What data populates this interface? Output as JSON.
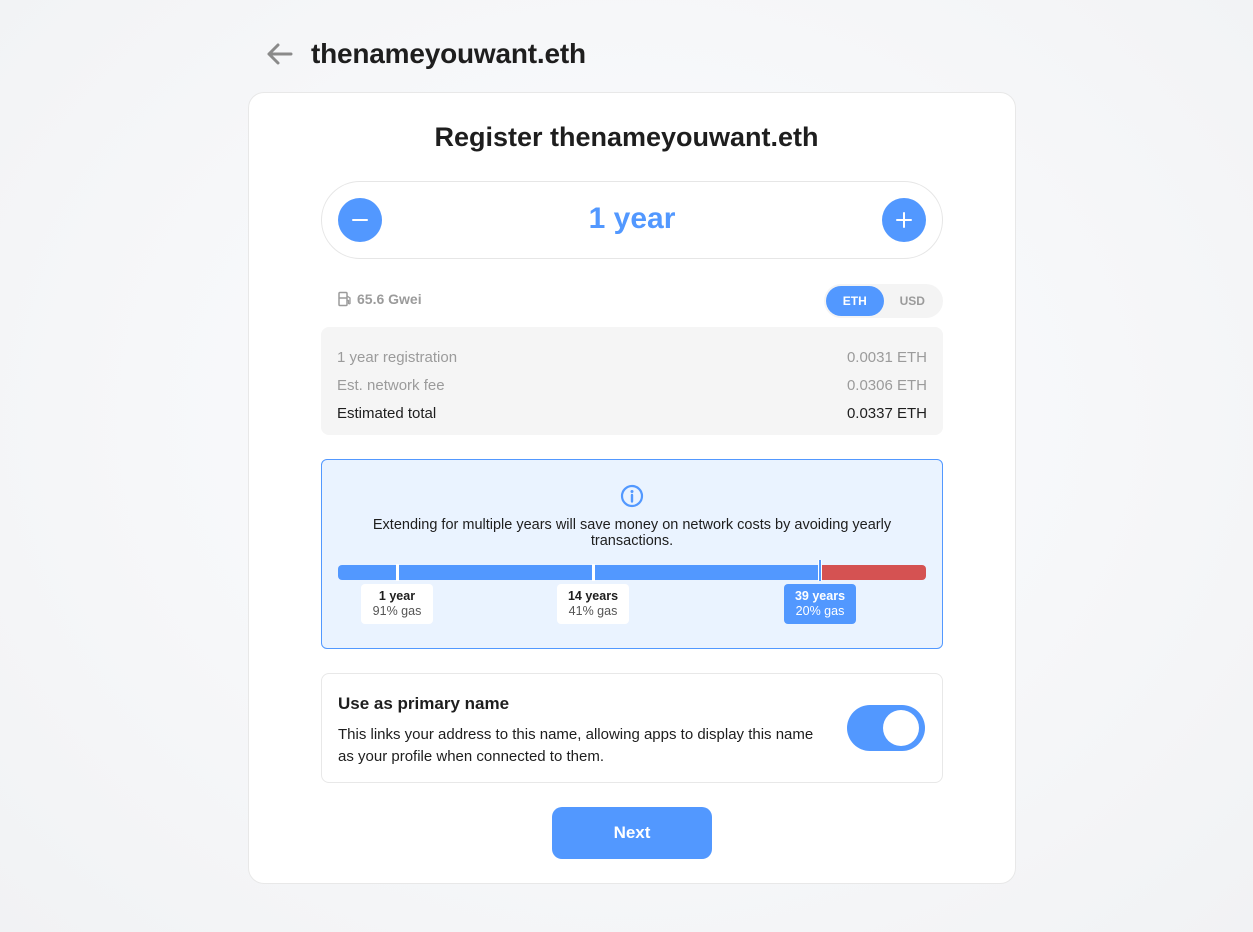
{
  "header": {
    "title": "thenameyouwant.eth",
    "back_icon": "arrow-left-icon"
  },
  "card": {
    "title": "Register thenameyouwant.eth"
  },
  "stepper": {
    "value": "1 year",
    "decrement_icon": "minus-icon",
    "increment_icon": "plus-icon"
  },
  "gas": {
    "icon": "gas-pump-icon",
    "label": "65.6 Gwei"
  },
  "currency": {
    "options": [
      "ETH",
      "USD"
    ],
    "selected": "ETH"
  },
  "price": {
    "rows": [
      {
        "label": "1 year registration",
        "value": "0.0031 ETH"
      },
      {
        "label": "Est. network fee",
        "value": "0.0306 ETH"
      },
      {
        "label": "Estimated total",
        "value": "0.0337 ETH"
      }
    ]
  },
  "info": {
    "icon": "info-icon",
    "text": "Extending for multiple years will save money on network costs by avoiding yearly transactions.",
    "markers": [
      {
        "years": "1 year",
        "gas": "91% gas"
      },
      {
        "years": "14 years",
        "gas": "41% gas"
      },
      {
        "years": "39 years",
        "gas": "20% gas",
        "active": true
      }
    ]
  },
  "primary_name": {
    "title": "Use as primary name",
    "description": "This links your address to this name, allowing apps to display this name as your profile when connected to them.",
    "enabled": true
  },
  "next_button": {
    "label": "Next"
  },
  "colors": {
    "accent": "#5298ff",
    "danger": "#d55252",
    "info_bg": "#eaf3ff"
  }
}
